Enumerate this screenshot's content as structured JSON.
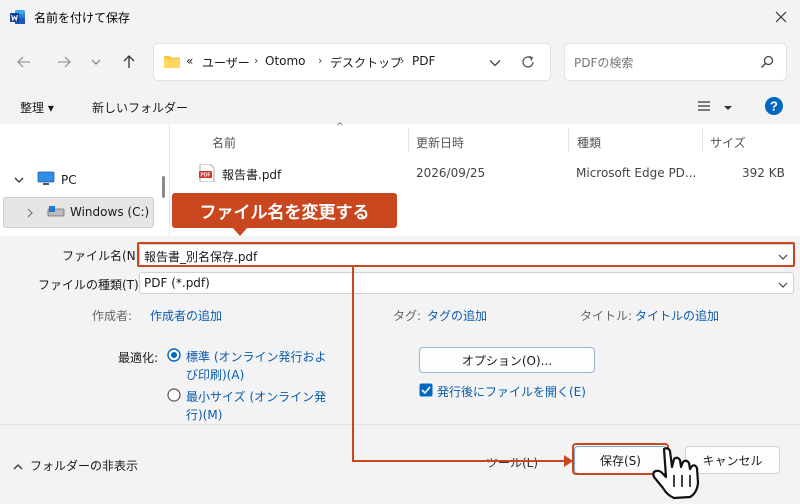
{
  "window": {
    "title": "名前を付けて保存",
    "icon": "word-app-icon",
    "accent_color": "#0067c0",
    "annotation_color": "#c8471f"
  },
  "nav": {
    "back_icon": "arrow-left-icon",
    "forward_icon": "arrow-right-icon",
    "recent_icon": "chevron-down-icon",
    "up_icon": "arrow-up-icon",
    "breadcrumb_prefix": "«",
    "breadcrumb": [
      "ユーザー",
      "Otomo",
      "デスクトップ",
      "PDF"
    ],
    "refresh_icon": "refresh-icon",
    "search_placeholder": "PDFの検索"
  },
  "commands": {
    "organize": "整理 ▾",
    "new_folder": "新しいフォルダー"
  },
  "navpane": {
    "items": [
      {
        "label": "PC",
        "icon": "pc-icon",
        "expanded": true
      },
      {
        "label": "Windows (C:)",
        "icon": "drive-icon",
        "expanded": false,
        "selected": true
      }
    ]
  },
  "filelist": {
    "columns": [
      "名前",
      "更新日時",
      "種類",
      "サイズ"
    ],
    "rows": [
      {
        "name": "報告書.pdf",
        "modified": "2026/09/25",
        "type": "Microsoft Edge PD...",
        "size": "392 KB"
      }
    ]
  },
  "form": {
    "filename_label": "ファイル名(N):",
    "filename_value": "報告書_別名保存.pdf",
    "filetype_label": "ファイルの種類(T):",
    "filetype_value": "PDF (*.pdf)",
    "author_label": "作成者:",
    "author_link": "作成者の追加",
    "tags_label": "タグ:",
    "tags_link": "タグの追加",
    "title_label": "タイトル:",
    "title_link": "タイトルの追加",
    "optimize_label": "最適化:",
    "optimize_standard_line1": "標準 (オンライン発行およ",
    "optimize_standard_line2": "び印刷)(A)",
    "optimize_min_line1": "最小サイズ (オンライン発",
    "optimize_min_line2": "行)(M)",
    "optimize_selected": "standard",
    "options_button": "オプション(O)...",
    "open_after_label": "発行後にファイルを開く(E)",
    "open_after_checked": true
  },
  "footer": {
    "hide_folders": "フォルダーの非表示",
    "tools": "ツール(L)",
    "save": "保存(S)",
    "cancel": "キャンセル"
  },
  "annotation": {
    "callout": "ファイル名を変更する"
  }
}
